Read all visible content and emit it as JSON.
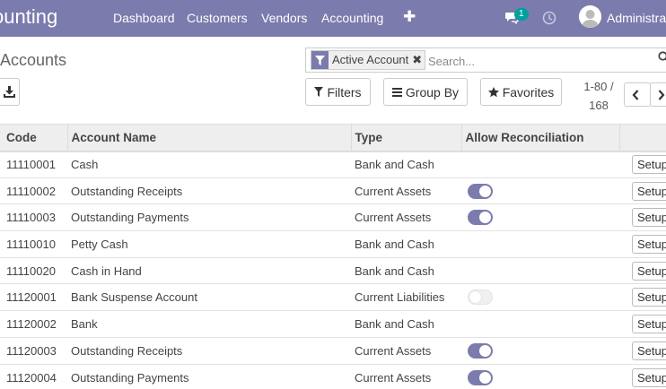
{
  "app": {
    "title": "ounting",
    "nav": [
      "Dashboard",
      "Customers",
      "Vendors",
      "Accounting"
    ],
    "messages_count": "1",
    "user_name": "Administra"
  },
  "control_panel": {
    "page_title": "Accounts",
    "facet_label": "Active Account",
    "search_placeholder": "Search...",
    "filters_label": "Filters",
    "groupby_label": "Group By",
    "favorites_label": "Favorites",
    "pager_range": "1-80 /",
    "pager_total": "168"
  },
  "table": {
    "columns": [
      "Code",
      "Account Name",
      "Type",
      "Allow Reconciliation"
    ],
    "setup_label": "Setup",
    "rows": [
      {
        "code": "11110001",
        "name": "Cash",
        "type": "Bank and Cash",
        "reconcile": null
      },
      {
        "code": "11110002",
        "name": "Outstanding Receipts",
        "type": "Current Assets",
        "reconcile": true
      },
      {
        "code": "11110003",
        "name": "Outstanding Payments",
        "type": "Current Assets",
        "reconcile": true
      },
      {
        "code": "11110010",
        "name": "Petty Cash",
        "type": "Bank and Cash",
        "reconcile": null
      },
      {
        "code": "11110020",
        "name": "Cash in Hand",
        "type": "Bank and Cash",
        "reconcile": null
      },
      {
        "code": "11120001",
        "name": "Bank Suspense Account",
        "type": "Current Liabilities",
        "reconcile": false
      },
      {
        "code": "11120002",
        "name": "Bank",
        "type": "Bank and Cash",
        "reconcile": null
      },
      {
        "code": "11120003",
        "name": "Outstanding Receipts",
        "type": "Current Assets",
        "reconcile": true
      },
      {
        "code": "11120004",
        "name": "Outstanding Payments",
        "type": "Current Assets",
        "reconcile": true
      }
    ]
  },
  "colors": {
    "brand": "#7c7bad",
    "badge": "#00a09d"
  }
}
